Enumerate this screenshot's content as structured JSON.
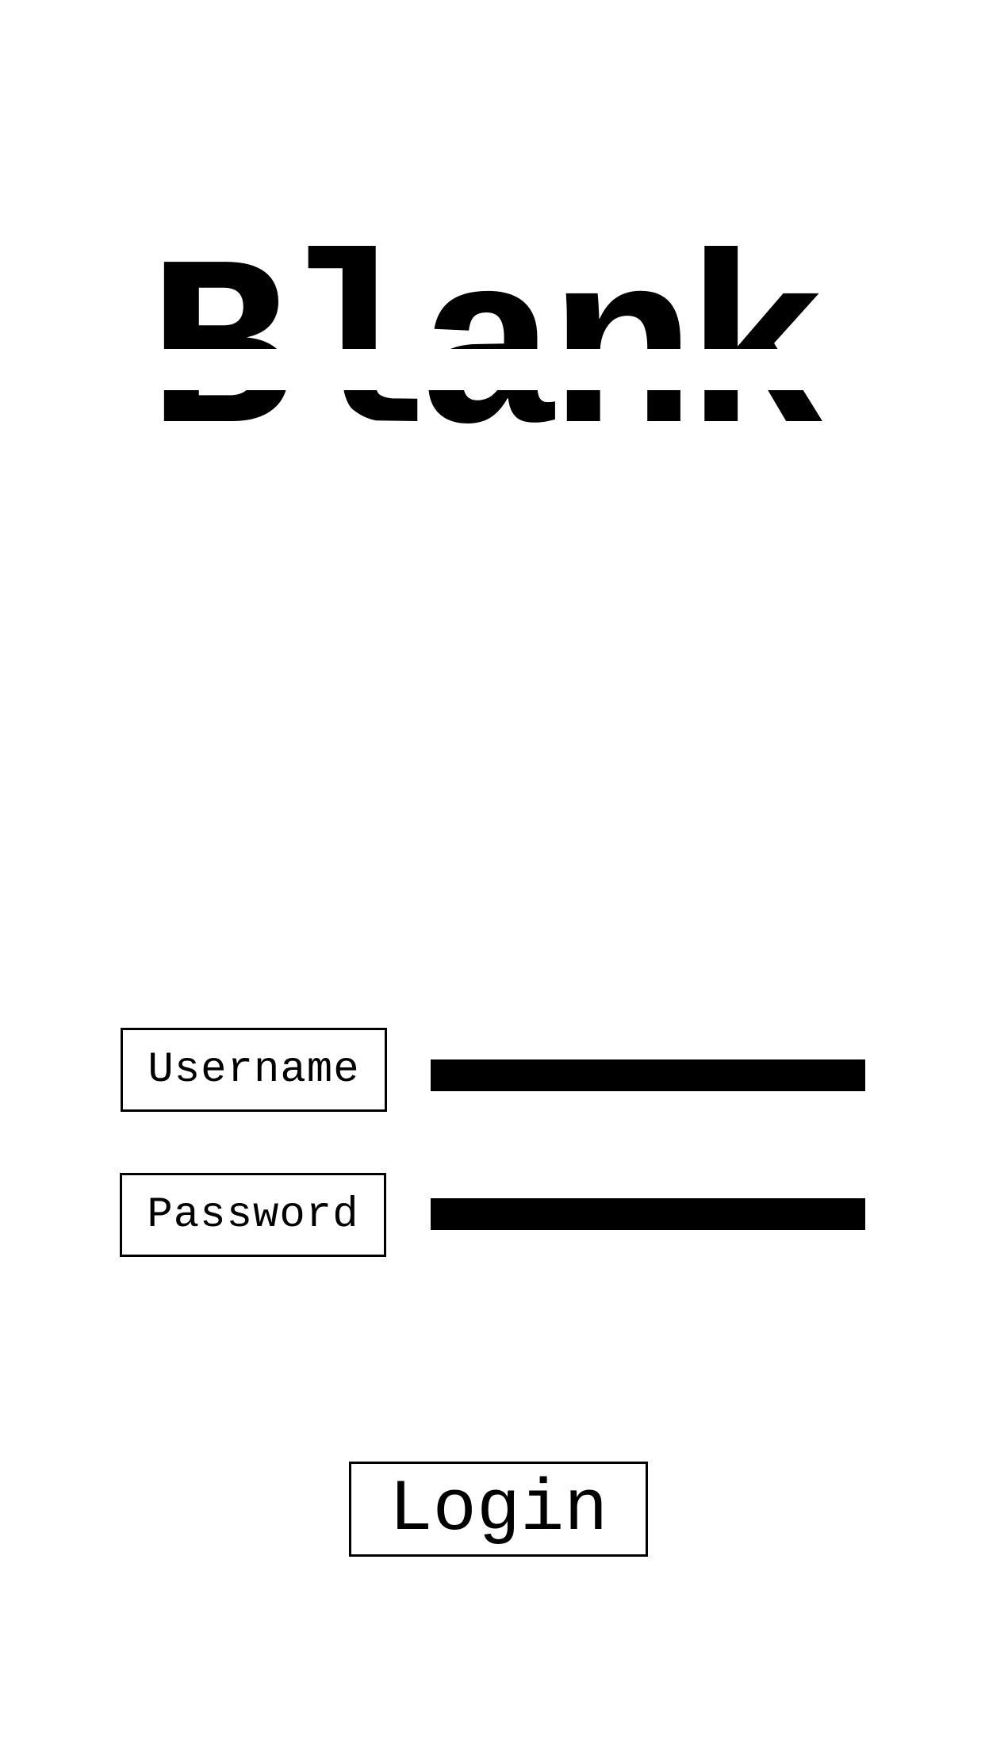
{
  "app": {
    "title": "Blank"
  },
  "form": {
    "username": {
      "label": "Username",
      "value": "",
      "placeholder": ""
    },
    "password": {
      "label": "Password",
      "value": "",
      "placeholder": ""
    }
  },
  "actions": {
    "login_label": "Login"
  },
  "colors": {
    "background": "#ffffff",
    "foreground": "#000000"
  }
}
